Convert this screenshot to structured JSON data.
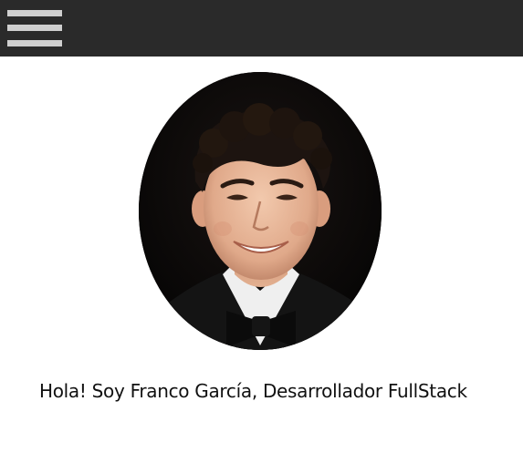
{
  "header": {
    "menu_icon": "hamburger-menu-icon",
    "background_color": "#2a2a2a"
  },
  "profile": {
    "photo_description": "profile-photo",
    "intro_text": "Hola! Soy Franco García, Desarrollador FullStack"
  }
}
